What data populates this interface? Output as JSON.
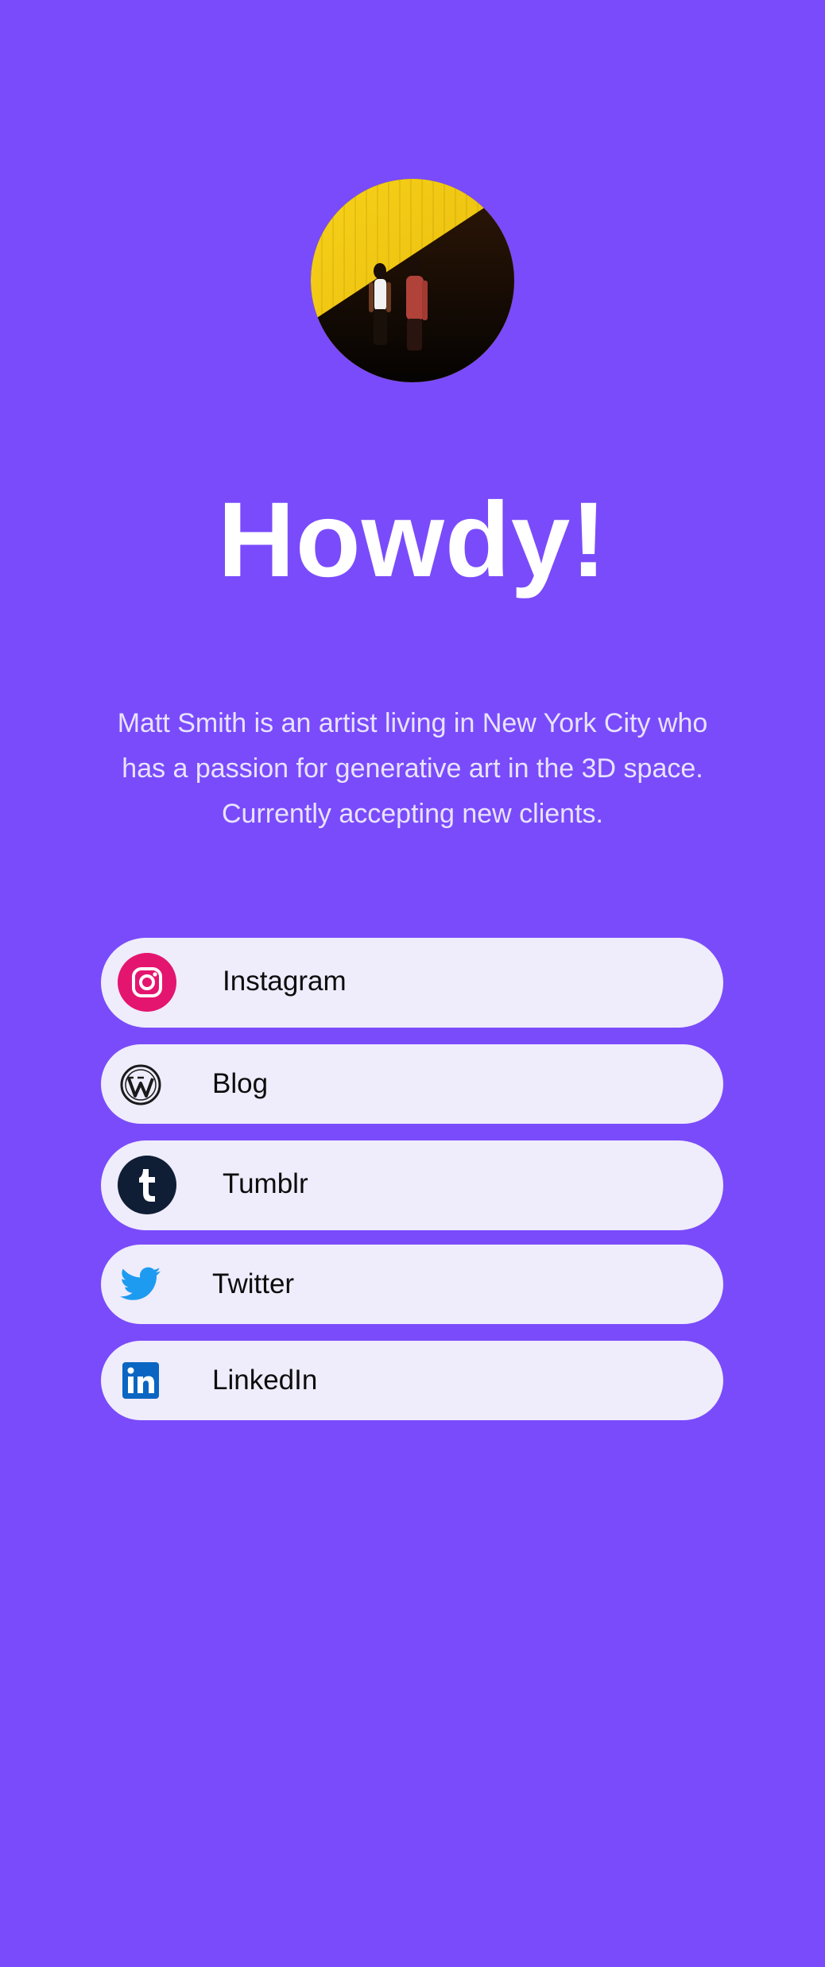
{
  "profile": {
    "headline": "Howdy!",
    "bio": "Matt Smith is an artist living in New York City who has a passion for generative art in the 3D space. Currently accepting new clients."
  },
  "links": [
    {
      "label": "Instagram",
      "icon": "instagram-icon",
      "color": "#e4156f"
    },
    {
      "label": "Blog",
      "icon": "wordpress-icon",
      "color": "#1a1a1a"
    },
    {
      "label": "Tumblr",
      "icon": "tumblr-icon",
      "color": "#0f1e35"
    },
    {
      "label": "Twitter",
      "icon": "twitter-icon",
      "color": "#1d9bf0"
    },
    {
      "label": "LinkedIn",
      "icon": "linkedin-icon",
      "color": "#0a66c2"
    }
  ],
  "theme": {
    "background": "#7a4bfb",
    "card": "#efecfc",
    "headline_color": "#ffffff",
    "bio_color": "#e9e3ff"
  }
}
